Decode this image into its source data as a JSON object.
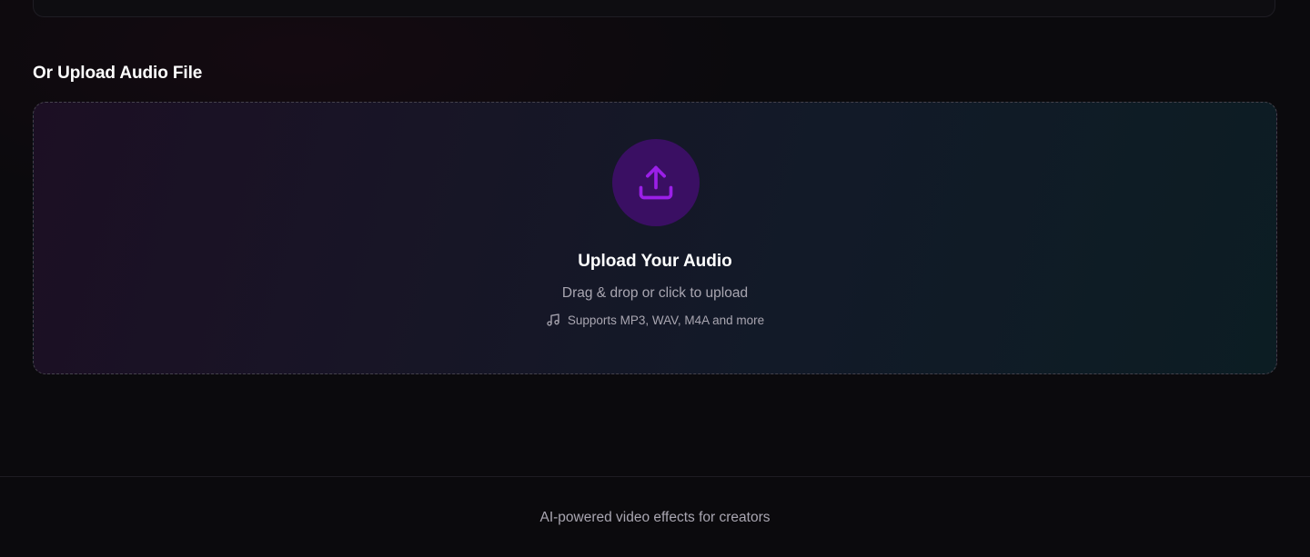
{
  "upload_section": {
    "title": "Or Upload Audio File",
    "dropzone": {
      "heading": "Upload Your Audio",
      "instruction": "Drag & drop or click to upload",
      "supported_formats": "Supports MP3, WAV, M4A and more",
      "upload_icon": "upload-icon",
      "format_icon": "music-note-icon"
    }
  },
  "footer": {
    "tagline": "AI-powered video effects for creators"
  },
  "colors": {
    "background": "#0b0a0d",
    "accent": "#9b1fe8",
    "icon_circle": "#3a0f63",
    "muted_text": "#a9a6b1"
  }
}
